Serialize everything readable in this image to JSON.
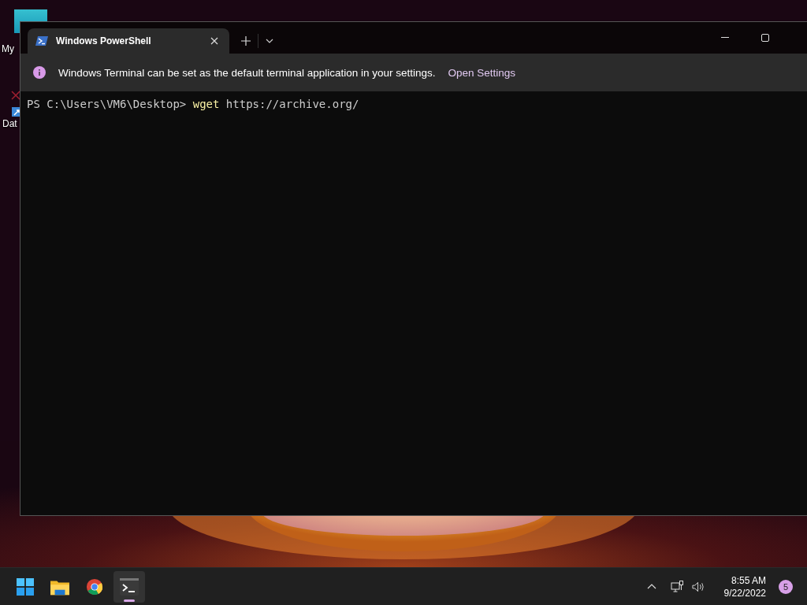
{
  "desktop": {
    "icons": [
      {
        "label": "My",
        "kind": "monitor"
      },
      {
        "label": "Dat",
        "kind": "shortcut"
      }
    ]
  },
  "window": {
    "tabs": [
      {
        "title": "Windows PowerShell",
        "selected": true
      }
    ],
    "infobar": {
      "message": "Windows Terminal can be set as the default terminal application in your settings.",
      "link": "Open Settings"
    },
    "terminal": {
      "lines": [
        [
          {
            "kind": "prompt",
            "text": "PS C:\\Users\\VM6\\Desktop> "
          },
          {
            "kind": "command",
            "text": "wget"
          },
          {
            "kind": "argument",
            "text": " https://archive.org/"
          }
        ]
      ]
    }
  },
  "taskbar": {
    "apps": [
      {
        "kind": "start",
        "selected": false
      },
      {
        "kind": "explorer",
        "selected": false
      },
      {
        "kind": "chrome",
        "selected": false
      },
      {
        "kind": "terminal",
        "selected": true
      }
    ],
    "time": "8:55 AM",
    "date": "9/22/2022",
    "notifications": "5"
  }
}
